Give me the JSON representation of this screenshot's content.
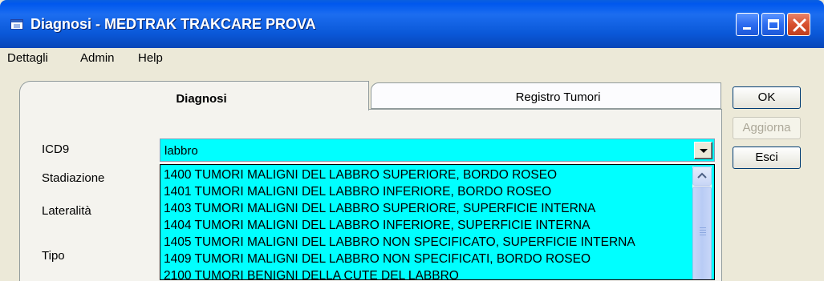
{
  "window": {
    "title": "Diagnosi - MEDTRAK TRAKCARE PROVA"
  },
  "menu": [
    {
      "label": "Dettagli"
    },
    {
      "label": "Admin"
    },
    {
      "label": "Help"
    }
  ],
  "tabs": [
    {
      "label": "Diagnosi",
      "active": true
    },
    {
      "label": "Registro Tumori",
      "active": false
    }
  ],
  "form": {
    "icd9_label": "ICD9",
    "icd9_value": "labbro",
    "stadiazione_label": "Stadiazione",
    "lateralita_label": "Lateralità",
    "tipo_label": "Tipo"
  },
  "dropdown": {
    "items": [
      "1400 TUMORI MALIGNI DEL LABBRO SUPERIORE, BORDO ROSEO",
      "1401 TUMORI MALIGNI DEL LABBRO INFERIORE, BORDO ROSEO",
      "1403 TUMORI MALIGNI DEL LABBRO SUPERIORE, SUPERFICIE INTERNA",
      "1404 TUMORI MALIGNI DEL LABBRO INFERIORE, SUPERFICIE INTERNA",
      "1405 TUMORI MALIGNI DEL LABBRO NON SPECIFICATO, SUPERFICIE INTERNA",
      "1409 TUMORI MALIGNI DEL LABBRO NON SPECIFICATI, BORDO ROSEO",
      "2100 TUMORI BENIGNI DELLA CUTE DEL LABBRO"
    ]
  },
  "buttons": {
    "ok": "OK",
    "aggiorna": "Aggiorna",
    "esci": "Esci"
  },
  "colors": {
    "field_bg": "#00FFFF",
    "titlebar": "#0A5FE0"
  }
}
